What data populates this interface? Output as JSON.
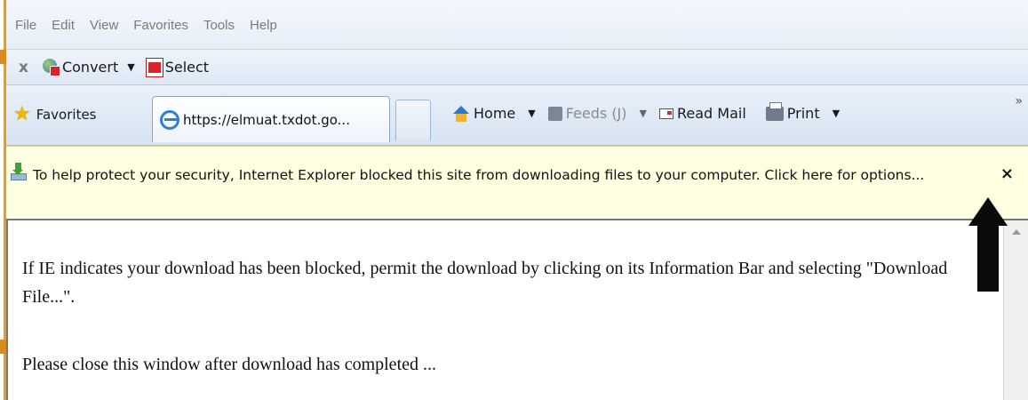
{
  "menu": {
    "items": [
      "File",
      "Edit",
      "View",
      "Favorites",
      "Tools",
      "Help"
    ]
  },
  "command_bar": {
    "close_glyph": "x",
    "convert_label": "Convert",
    "convert_caret": "▼",
    "select_label": "Select"
  },
  "tab_bar": {
    "favorites_label": "Favorites",
    "active_tab_title": "https://elmuat.txdot.go...",
    "home_label": "Home",
    "home_caret": "▼",
    "feeds_label": "Feeds (J)",
    "feeds_caret": "▼",
    "read_mail_label": "Read Mail",
    "print_label": "Print",
    "print_caret": "▼",
    "more_glyph": "»"
  },
  "info_bar": {
    "message": "To help protect your security, Internet Explorer blocked this site from downloading files to your computer. Click here for options...",
    "close_glyph": "×"
  },
  "content": {
    "paragraph1": "If IE indicates your download has been blocked, permit the download by clicking on its Information Bar and selecting \"Download File...\".",
    "paragraph2": "Please close this window after download has completed ..."
  },
  "colors": {
    "info_bar_bg": "#ffffe1",
    "arrow": "#0a0a0a"
  }
}
